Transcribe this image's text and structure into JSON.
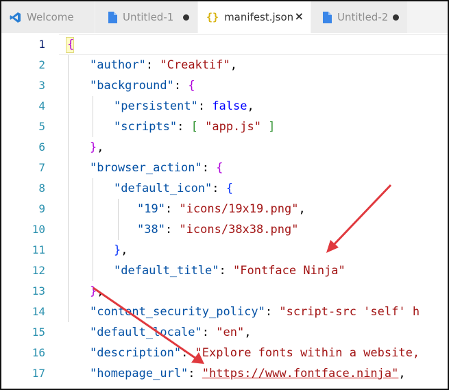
{
  "tabs": [
    {
      "label": "Welcome",
      "icon": "vscode-logo-icon",
      "state": "inactive",
      "indicator": "none"
    },
    {
      "label": "Untitled-1",
      "icon": "file-icon",
      "state": "inactive",
      "indicator": "dirty"
    },
    {
      "label": "manifest.json",
      "icon": "json-braces-icon",
      "state": "active",
      "indicator": "close"
    },
    {
      "label": "Untitled-2",
      "icon": "file-icon",
      "state": "inactive",
      "indicator": "dirty"
    }
  ],
  "tab_close_glyph": "×",
  "line_numbers": [
    "1",
    "2",
    "3",
    "4",
    "5",
    "6",
    "7",
    "8",
    "9",
    "10",
    "11",
    "12",
    "13",
    "14",
    "15",
    "16",
    "17"
  ],
  "code": {
    "l1_open": "{",
    "l2_key": "\"author\"",
    "l2_val": "\"Creaktif\"",
    "l3_key": "\"background\"",
    "l3_open": "{",
    "l4_key": "\"persistent\"",
    "l4_val": "false",
    "l5_key": "\"scripts\"",
    "l5_open": "[",
    "l5_val": "\"app.js\"",
    "l5_close": "]",
    "l6_close": "}",
    "l7_key": "\"browser_action\"",
    "l7_open": "{",
    "l8_key": "\"default_icon\"",
    "l8_open": "{",
    "l9_key": "\"19\"",
    "l9_val": "\"icons/19x19.png\"",
    "l10_key": "\"38\"",
    "l10_val": "\"icons/38x38.png\"",
    "l11_close": "}",
    "l12_key": "\"default_title\"",
    "l12_val": "\"Fontface Ninja\"",
    "l13_close": "}",
    "l14_key": "\"content_security_policy\"",
    "l14_val": "\"script-src 'self' h",
    "l15_key": "\"default_locale\"",
    "l15_val": "\"en\"",
    "l16_key": "\"description\"",
    "l16_val": "\"Explore fonts within a website,",
    "l17_key": "\"homepage_url\"",
    "l17_val_q1": "\"",
    "l17_val_url": "https://www.fontface.ninja",
    "l17_val_q2": "\""
  },
  "colors": {
    "key": "#0451a5",
    "string": "#a31515",
    "keyword": "#0000ff",
    "line_number": "#2b91af",
    "annotation_arrow": "#e0393e",
    "json_icon": "#d8b414",
    "file_icon": "#3a86e8",
    "vscode_icon": "#2a7fd4"
  }
}
